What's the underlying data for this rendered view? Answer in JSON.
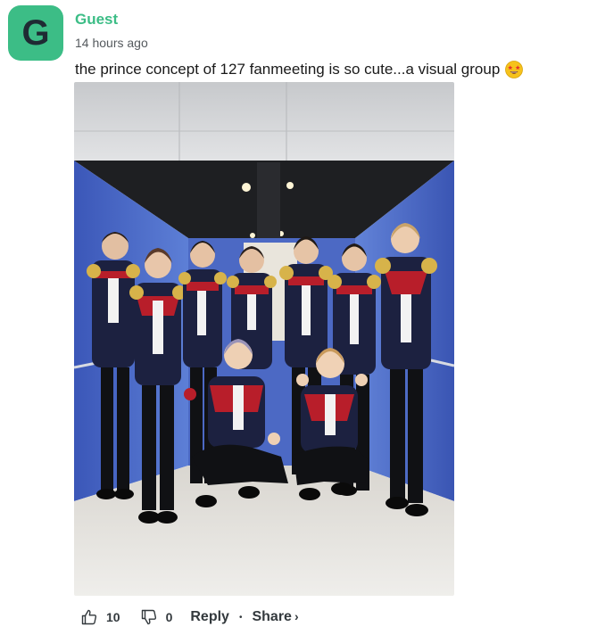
{
  "comment": {
    "avatar_letter": "G",
    "author": "Guest",
    "timestamp": "14 hours ago",
    "text": "the prince concept of 127 fanmeeting is so cute...a visual group",
    "emoji": "star-struck-emoji",
    "image": "group-photo"
  },
  "actions": {
    "like_count": "10",
    "dislike_count": "0",
    "reply_label": "Reply",
    "share_label": "Share",
    "share_chevron": "›",
    "separator": "•"
  },
  "colors": {
    "accent": "#3cbd86",
    "text": "#1a1a1a",
    "muted": "#555a5e"
  }
}
